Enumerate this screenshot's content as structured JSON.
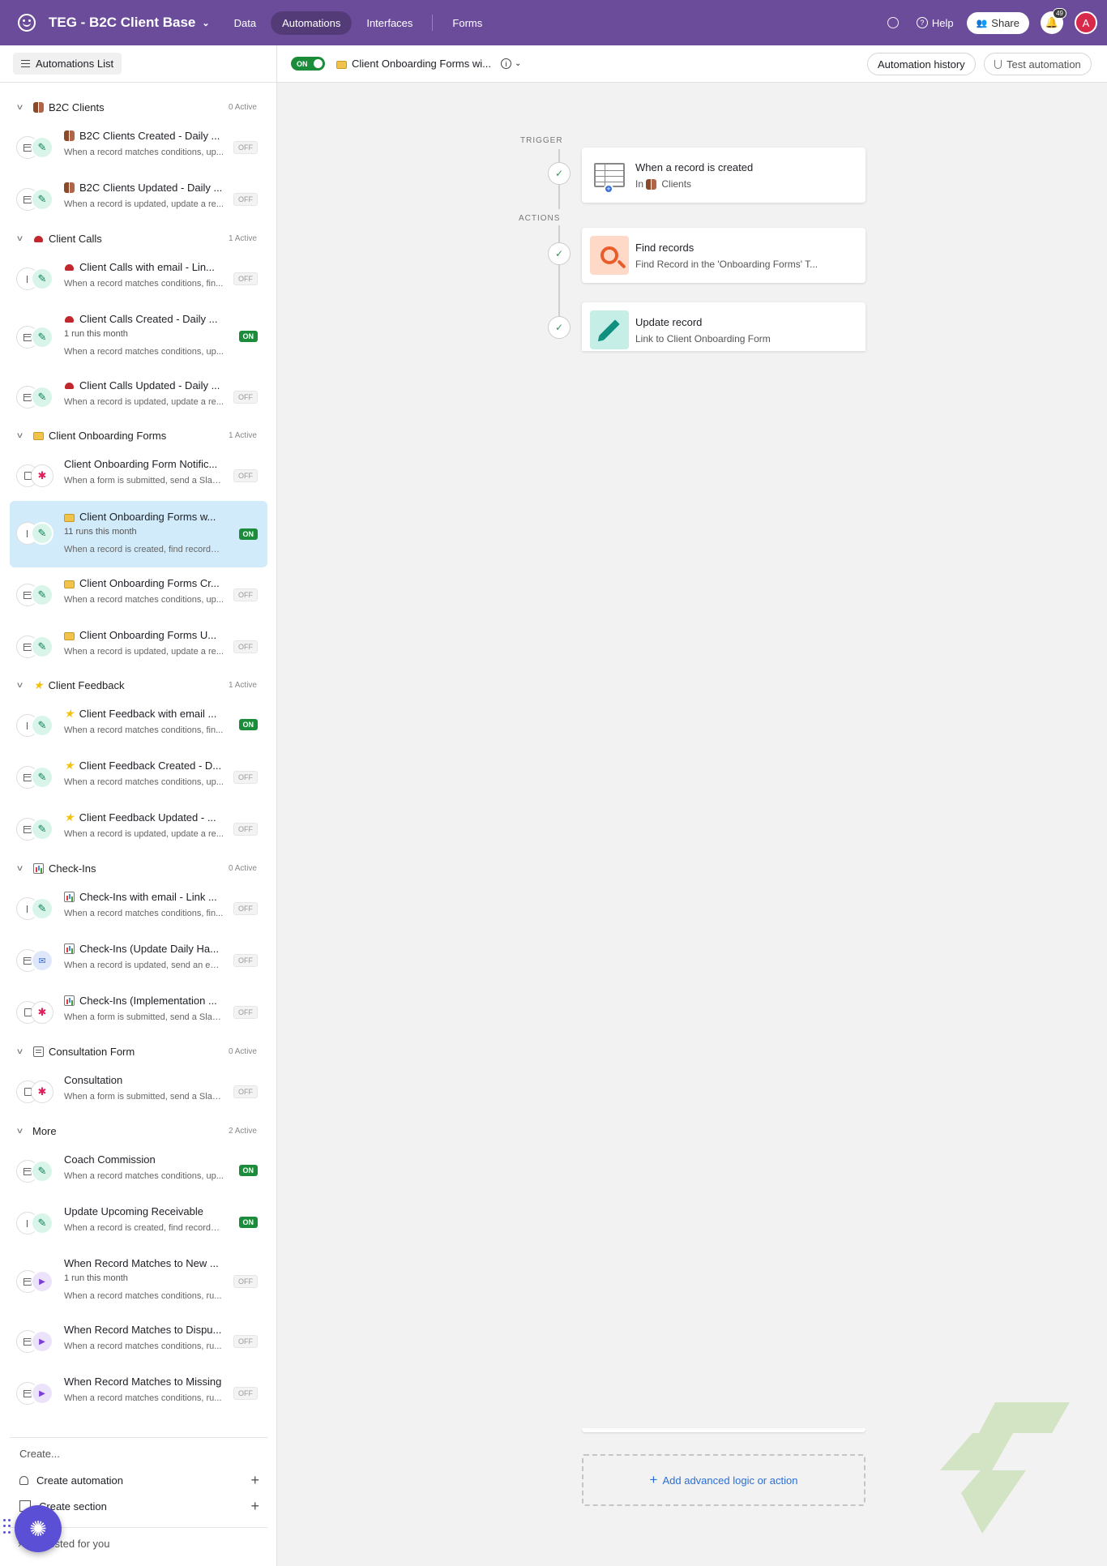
{
  "header": {
    "base_name": "TEG - B2C Client Base",
    "nav": [
      "Data",
      "Automations",
      "Interfaces",
      "Forms"
    ],
    "help_label": "Help",
    "share_label": "Share",
    "notification_count": "49",
    "avatar_initial": "A"
  },
  "sidebar": {
    "list_button": "Automations List",
    "sections": [
      {
        "title": "B2C Clients",
        "count": "0 Active"
      },
      {
        "title": "Client Calls",
        "count": "1 Active"
      },
      {
        "title": "Client Onboarding Forms",
        "count": "1 Active"
      },
      {
        "title": "Client Feedback",
        "count": "1 Active"
      },
      {
        "title": "Check-Ins",
        "count": "0 Active"
      },
      {
        "title": "Consultation Form",
        "count": "0 Active"
      },
      {
        "title": "More",
        "count": "2 Active"
      }
    ],
    "items": [
      {
        "title": "B2C Clients Created - Daily ...",
        "runs": "",
        "desc": "When a record matches conditions, up...",
        "status": "OFF"
      },
      {
        "title": "B2C Clients Updated - Daily ...",
        "runs": "",
        "desc": "When a record is updated, update a re...",
        "status": "OFF"
      },
      {
        "title": "Client Calls with email - Lin...",
        "runs": "",
        "desc": "When a record matches conditions, fin...",
        "status": "OFF"
      },
      {
        "title": "Client Calls Created - Daily ...",
        "runs": "1 run this month",
        "desc": "When a record matches conditions, up...",
        "status": "ON"
      },
      {
        "title": "Client Calls Updated - Daily ...",
        "runs": "",
        "desc": "When a record is updated, update a re...",
        "status": "OFF"
      },
      {
        "title": "Client Onboarding Form Notific...",
        "runs": "",
        "desc": "When a form is submitted, send a Slac...",
        "status": "OFF"
      },
      {
        "title": "Client Onboarding Forms w...",
        "runs": "11 runs this month",
        "desc": "When a record is created, find records,...",
        "status": "ON"
      },
      {
        "title": "Client Onboarding Forms Cr...",
        "runs": "",
        "desc": "When a record matches conditions, up...",
        "status": "OFF"
      },
      {
        "title": "Client Onboarding Forms U...",
        "runs": "",
        "desc": "When a record is updated, update a re...",
        "status": "OFF"
      },
      {
        "title": "Client Feedback with email ...",
        "runs": "",
        "desc": "When a record matches conditions, fin...",
        "status": "ON"
      },
      {
        "title": "Client Feedback Created - D...",
        "runs": "",
        "desc": "When a record matches conditions, up...",
        "status": "OFF"
      },
      {
        "title": "Client Feedback Updated - ...",
        "runs": "",
        "desc": "When a record is updated, update a re...",
        "status": "OFF"
      },
      {
        "title": "Check-Ins with email - Link ...",
        "runs": "",
        "desc": "When a record matches conditions, fin...",
        "status": "OFF"
      },
      {
        "title": "Check-Ins (Update Daily Ha...",
        "runs": "",
        "desc": "When a record is updated, send an em...",
        "status": "OFF"
      },
      {
        "title": "Check-Ins (Implementation ...",
        "runs": "",
        "desc": "When a form is submitted, send a Slac...",
        "status": "OFF"
      },
      {
        "title": "Consultation",
        "runs": "",
        "desc": "When a form is submitted, send a Slac...",
        "status": "OFF"
      },
      {
        "title": "Coach Commission",
        "runs": "",
        "desc": "When a record matches conditions, up...",
        "status": "ON"
      },
      {
        "title": "Update Upcoming Receivable",
        "runs": "",
        "desc": "When a record is created, find records,...",
        "status": "ON"
      },
      {
        "title": "When Record Matches to New ...",
        "runs": "1 run this month",
        "desc": "When a record matches conditions, ru...",
        "status": "OFF"
      },
      {
        "title": "When Record Matches to Dispu...",
        "runs": "",
        "desc": "When a record matches conditions, ru...",
        "status": "OFF"
      },
      {
        "title": "When Record Matches to Missing",
        "runs": "",
        "desc": "When a record matches conditions, ru...",
        "status": "OFF"
      }
    ],
    "create_label": "Create...",
    "create_automation": "Create automation",
    "create_section": "Create section",
    "suggested": "Suggested for you"
  },
  "main": {
    "toggle_label": "ON",
    "automation_name": "Client Onboarding Forms wi...",
    "history_button": "Automation history",
    "test_button": "Test automation",
    "trigger_label": "TRIGGER",
    "actions_label": "ACTIONS",
    "steps": [
      {
        "title": "When a record is created",
        "subtitle_prefix": "In",
        "subtitle": "Clients"
      },
      {
        "title": "Find records",
        "subtitle": "Find Record in the 'Onboarding Forms' T..."
      },
      {
        "title": "Update record",
        "subtitle": "Link to Client Onboarding Form"
      }
    ],
    "add_advanced": "Add advanced logic or action"
  },
  "colors": {
    "topbar": "#6b4c9a",
    "selected_item": "#d1ebfa",
    "on_badge": "#1b8c3a",
    "link_blue": "#2a6fd6"
  }
}
